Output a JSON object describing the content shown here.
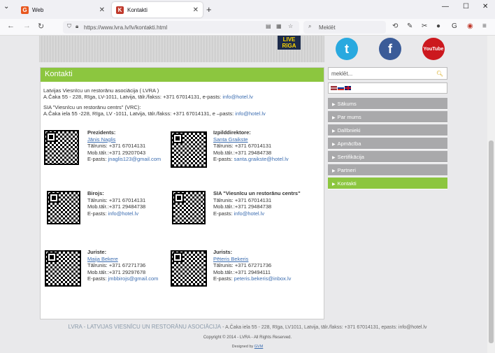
{
  "browser": {
    "tabs": [
      {
        "label": "Web",
        "icon": "g-favicon",
        "color": "#e8571e",
        "letter": "G"
      },
      {
        "label": "Kontakti",
        "icon": "hotel-favicon",
        "color": "#c0392b",
        "letter": "K"
      }
    ],
    "new_tab": "+",
    "url": "https://www.lvra.lv/lv/kontakti.html",
    "search_placeholder": "Meklēt"
  },
  "header": {
    "logo_line1": "LIVE",
    "logo_line2": "RīGA",
    "social": [
      {
        "name": "twitter",
        "label": "t",
        "color": "#29a9df"
      },
      {
        "name": "facebook",
        "label": "f",
        "color": "#3a5b98"
      },
      {
        "name": "youtube",
        "label": "YouTube",
        "color": "#cc181e"
      }
    ]
  },
  "content": {
    "title": "Kontakti",
    "org1_name": "Latvijas Viesnīcu un restorānu asociācija ( LVRA )",
    "org1_addr": "A.Čaka 55 - 228, Rīga, LV-1011, Latvija, tālr./fakss: +371 67014131, e-pasts:",
    "org1_email": "info@hotel.lv",
    "org2_name": "SIA \"Viesnīcu un restorānu centrs\" (VRC):",
    "org2_addr": "A.Čaka iela 55 -228, Rīga, LV -1011, Latvija, tālr./fakss: +371 67014131, e –pasts:",
    "org2_email": "info@hotel.lv",
    "contacts": [
      {
        "role": "Prezidents:",
        "person": "Jānis Naglis",
        "phone": "Tālrunis: +371 67014131",
        "mobile": "Mob.tālr.:+371 29207043",
        "email_label": "E-pasts:",
        "email": "jnaglis123@gmail.com"
      },
      {
        "role": "Izpilddirektore:",
        "person": "Santa Graikste",
        "phone": "Tālrunis: +371 67014131",
        "mobile": "Mob.tālr.:+371 29484738",
        "email_label": "E-pasts:",
        "email": "santa.graikste@hotel.lv"
      },
      {
        "role": "Birojs:",
        "person": "",
        "phone": "Tālrunis: +371 67014131",
        "mobile": "Mob.tālr.:+371 29484738",
        "email_label": "E-pasts:",
        "email": "info@hotel.lv"
      },
      {
        "role": "SIA \"Viesnīcu un restorānu centrs\"",
        "person": "",
        "phone": "Tālrunis: +371 67014131",
        "mobile": "Mob.tālr.:+371 29484738",
        "email_label": "E-pasts:",
        "email": "info@hotel.lv"
      },
      {
        "role": "Juriste:",
        "person": "Maija Bekere",
        "phone": "Tālrunis: +371 67271736",
        "mobile": "Mob.tālr.:+371 29297678",
        "email_label": "E-pasts:",
        "email": "jmbbirojs@gmail.com"
      },
      {
        "role": "Jurists:",
        "person": "Pēteris Bekeris",
        "phone": "Tālrunis: +371 67271736",
        "mobile": "Mob.tālr.:+371 29494111",
        "email_label": "E-pasts:",
        "email": "peteris.bekeris@inbox.lv"
      }
    ]
  },
  "sidebar": {
    "search_placeholder": "meklēt...",
    "menu": [
      {
        "label": "Sākums",
        "active": false
      },
      {
        "label": "Par mums",
        "active": false
      },
      {
        "label": "Dalībnieki",
        "active": false
      },
      {
        "label": "Apmācība",
        "active": false
      },
      {
        "label": "Sertifikācija",
        "active": false
      },
      {
        "label": "Partneri",
        "active": false
      },
      {
        "label": "Kontakti",
        "active": true
      }
    ]
  },
  "footer": {
    "org": "LVRA - LATVIJAS VIESNĪCU UN RESTORĀNU ASOCIĀCIJA",
    "address": " - A.Čaka iela 55 - 228, Rīga, LV1011, Latvija, tālr./fakss: +371 67014131, epasts: info@hotel.lv",
    "copyright": "Copyright © 2014 - LVRA - All Rights Reserved.",
    "designed_by_label": "Designed by",
    "designed_by": "GVM"
  }
}
